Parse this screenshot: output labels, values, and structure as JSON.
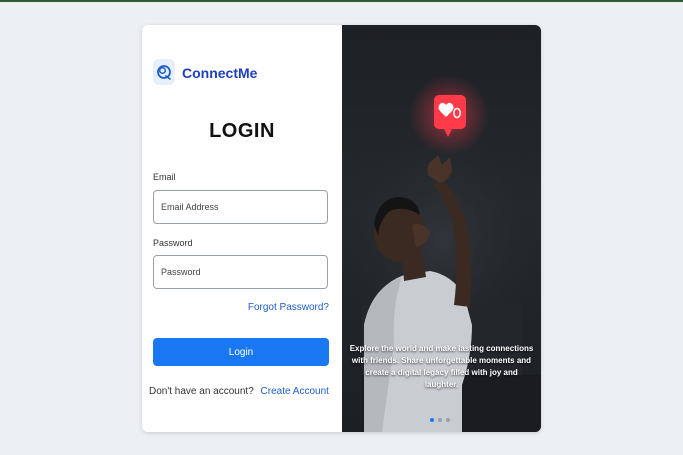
{
  "brand": {
    "name": "ConnectMe",
    "logo_icon": "connectme-logo-icon"
  },
  "login": {
    "title": "LOGIN",
    "email_label": "Email",
    "email_placeholder": "Email Address",
    "password_label": "Password",
    "password_placeholder": "Password",
    "forgot_link": "Forgot Password?",
    "submit_label": "Login",
    "signup_prompt": "Don't have an account?",
    "signup_link": "Create Account"
  },
  "hero": {
    "caption": "Explore the world and make lasting connections with friends. Share unforgettable moments and create a digital legacy filled with joy and laughter.",
    "notification_icon": "heart-notification-icon",
    "slides_total": 3,
    "active_slide": 1
  },
  "colors": {
    "accent": "#1a77f2",
    "brand": "#1f3fbf",
    "link": "#1f5fc8",
    "page_background": "#edf0f3",
    "notification": "#ff3b4a"
  }
}
